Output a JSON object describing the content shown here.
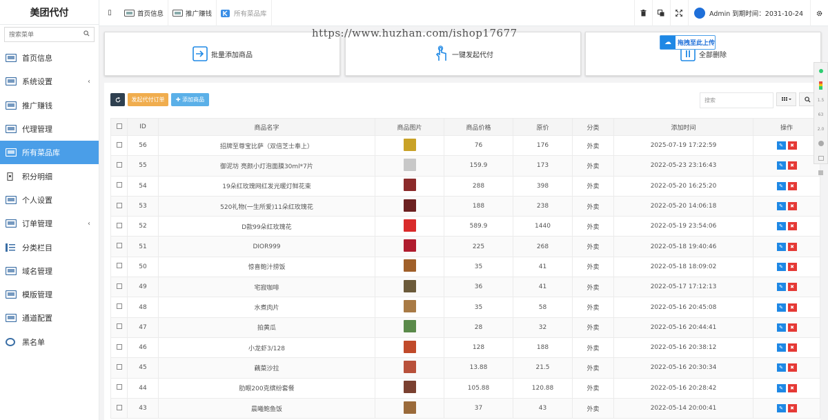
{
  "sidebar": {
    "logo": "美团代付",
    "search_placeholder": "搜索菜单",
    "items": [
      {
        "label": "首页信息",
        "icon": "screen-icon",
        "has_arrow": false,
        "active": false
      },
      {
        "label": "系统设置",
        "icon": "window-icon",
        "has_arrow": true,
        "active": false
      },
      {
        "label": "推广赚钱",
        "icon": "network-icon",
        "has_arrow": false,
        "active": false
      },
      {
        "label": "代理管理",
        "icon": "chart-icon",
        "has_arrow": false,
        "active": false
      },
      {
        "label": "所有菜品库",
        "icon": "monitor-icon",
        "has_arrow": false,
        "active": true
      },
      {
        "label": "积分明细",
        "icon": "document-icon",
        "has_arrow": false,
        "active": false
      },
      {
        "label": "个人设置",
        "icon": "window-icon",
        "has_arrow": false,
        "active": false
      },
      {
        "label": "订单管理",
        "icon": "grid-icon",
        "has_arrow": true,
        "active": false
      },
      {
        "label": "分类栏目",
        "icon": "list-icon",
        "has_arrow": false,
        "active": false
      },
      {
        "label": "域名管理",
        "icon": "browser-icon",
        "has_arrow": false,
        "active": false
      },
      {
        "label": "模版管理",
        "icon": "template-icon",
        "has_arrow": false,
        "active": false
      },
      {
        "label": "通道配置",
        "icon": "config-icon",
        "has_arrow": false,
        "active": false
      },
      {
        "label": "黑名单",
        "icon": "ring-icon",
        "has_arrow": false,
        "active": false
      }
    ]
  },
  "topbar": {
    "toggle": "▯",
    "tabs": [
      {
        "label": "首页信息",
        "current": false
      },
      {
        "label": "推广赚钱",
        "current": false
      },
      {
        "label": "所有菜品库",
        "current": true
      }
    ],
    "user_text": "Admin 到期时间：2031-10-24"
  },
  "watermark": "https://www.huzhan.com/ishop17677",
  "upload_badge": "拖拽至此上传",
  "cards": [
    {
      "label": "批量添加商品",
      "icon": "import-icon"
    },
    {
      "label": "一键发起代付",
      "icon": "touch-icon"
    },
    {
      "label": "全部删除",
      "icon": "pause-icon"
    }
  ],
  "toolbar": {
    "order_label": "发起代付订单",
    "add_label": "✚ 添加商品",
    "search_placeholder": "搜索"
  },
  "table": {
    "headers": [
      "",
      "ID",
      "商品名字",
      "商品图片",
      "商品价格",
      "原价",
      "分类",
      "添加时间",
      "操作"
    ],
    "rows": [
      {
        "id": "56",
        "name": "招牌至尊宝比萨（双倍芝士奉上）",
        "price": "76",
        "orig": "176",
        "cat": "外卖",
        "time": "2025-07-19 17:22:59",
        "color": "#c9a227"
      },
      {
        "id": "55",
        "name": "御泥坊 亮颜小灯泡面膜30ml*7片",
        "price": "159.9",
        "orig": "173",
        "cat": "外卖",
        "time": "2022-05-23 23:16:43",
        "color": "#c8c8c8"
      },
      {
        "id": "54",
        "name": "19朵红玫瑰网红发光暖灯鲜花束",
        "price": "288",
        "orig": "398",
        "cat": "外卖",
        "time": "2022-05-20 16:25:20",
        "color": "#8b2a2a"
      },
      {
        "id": "53",
        "name": "520礼物(一生所爱)11朵红玫瑰花",
        "price": "188",
        "orig": "238",
        "cat": "外卖",
        "time": "2022-05-20 14:06:18",
        "color": "#6b2020"
      },
      {
        "id": "52",
        "name": "D款99朵红玫瑰花",
        "price": "589.9",
        "orig": "1440",
        "cat": "外卖",
        "time": "2022-05-19 23:54:06",
        "color": "#d92b2b"
      },
      {
        "id": "51",
        "name": "DIOR999",
        "price": "225",
        "orig": "268",
        "cat": "外卖",
        "time": "2022-05-18 19:40:46",
        "color": "#b01c2e"
      },
      {
        "id": "50",
        "name": "惊喜鲍汁捞饭",
        "price": "35",
        "orig": "41",
        "cat": "外卖",
        "time": "2022-05-18 18:09:02",
        "color": "#a0602a"
      },
      {
        "id": "49",
        "name": "宅寂咖啡",
        "price": "36",
        "orig": "41",
        "cat": "外卖",
        "time": "2022-05-17 17:12:13",
        "color": "#6b5a3a"
      },
      {
        "id": "48",
        "name": "水煮肉片",
        "price": "35",
        "orig": "58",
        "cat": "外卖",
        "time": "2022-05-16 20:45:08",
        "color": "#a87a45"
      },
      {
        "id": "47",
        "name": "拍黄瓜",
        "price": "28",
        "orig": "32",
        "cat": "外卖",
        "time": "2022-05-16 20:44:41",
        "color": "#5a8a4a"
      },
      {
        "id": "46",
        "name": "小龙虾3/128",
        "price": "128",
        "orig": "188",
        "cat": "外卖",
        "time": "2022-05-16 20:38:12",
        "color": "#c04a2a"
      },
      {
        "id": "45",
        "name": "藕菜沙拉",
        "price": "13.88",
        "orig": "21.5",
        "cat": "外卖",
        "time": "2022-05-16 20:30:34",
        "color": "#b8503a"
      },
      {
        "id": "44",
        "name": "肋眼200克缤纷套餐",
        "price": "105.88",
        "orig": "120.88",
        "cat": "外卖",
        "time": "2022-05-16 20:28:42",
        "color": "#7a4030"
      },
      {
        "id": "43",
        "name": "晨曦鲍鱼饭",
        "price": "37",
        "orig": "43",
        "cat": "外卖",
        "time": "2022-05-14 20:00:41",
        "color": "#9a6a3a"
      }
    ]
  },
  "float_bar": [
    "1.5",
    "63",
    "2.0"
  ]
}
